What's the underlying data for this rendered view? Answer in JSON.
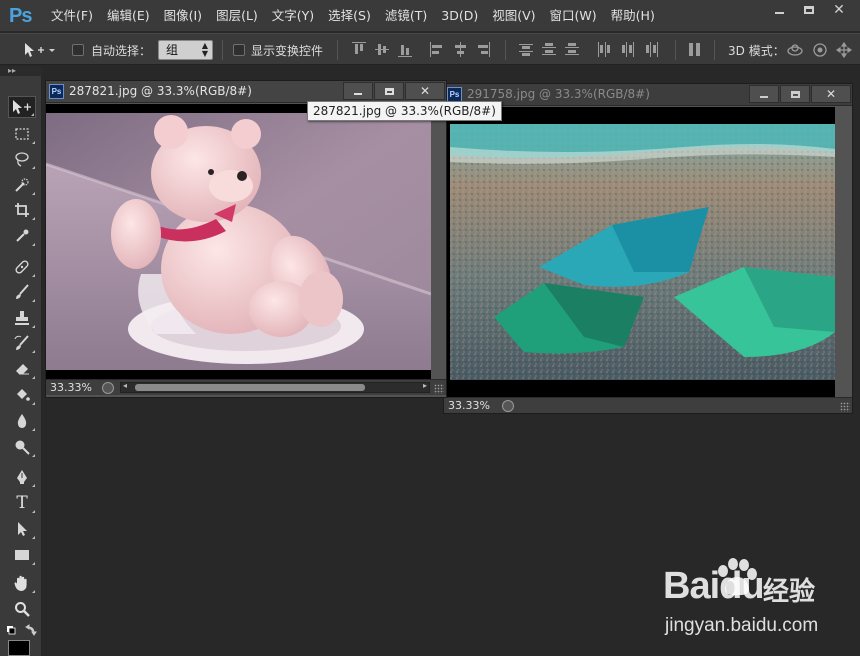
{
  "app": {
    "logo": "Ps",
    "menus": [
      "文件(F)",
      "编辑(E)",
      "图像(I)",
      "图层(L)",
      "文字(Y)",
      "选择(S)",
      "滤镜(T)",
      "3D(D)",
      "视图(V)",
      "窗口(W)",
      "帮助(H)"
    ]
  },
  "options_bar": {
    "auto_select_label": "自动选择：",
    "auto_select_value": "组",
    "show_transform_label": "显示变换控件",
    "mode_3d_label": "3D 模式："
  },
  "tools": {
    "icons": [
      "move-icon",
      "marquee-icon",
      "lasso-icon",
      "quick-select-icon",
      "crop-icon",
      "eyedropper-icon",
      "healing-icon",
      "brush-icon",
      "stamp-icon",
      "history-brush-icon",
      "eraser-icon",
      "paint-bucket-icon",
      "blur-icon",
      "dodge-icon",
      "pen-icon",
      "type-icon",
      "path-select-icon",
      "rectangle-icon",
      "hand-icon",
      "zoom-icon"
    ]
  },
  "documents": [
    {
      "title": "287821.jpg @ 33.3%(RGB/8#)",
      "zoom": "33.33%",
      "image_subject": "pink teddy bear sitting on a white plate"
    },
    {
      "title": "291758.jpg @ 33.3%(RGB/8#)",
      "zoom": "33.33%",
      "image_subject": "three paper boats on sand by the sea"
    }
  ],
  "tooltip": "287821.jpg @ 33.3%(RGB/8#)",
  "watermark": {
    "brand": "Baidu",
    "brand_cn": "经验",
    "url": "jingyan.baidu.com"
  },
  "colors": {
    "accent": "#4aa3df",
    "panel_bg": "#3a3a3a",
    "workspace_bg": "#282828"
  }
}
